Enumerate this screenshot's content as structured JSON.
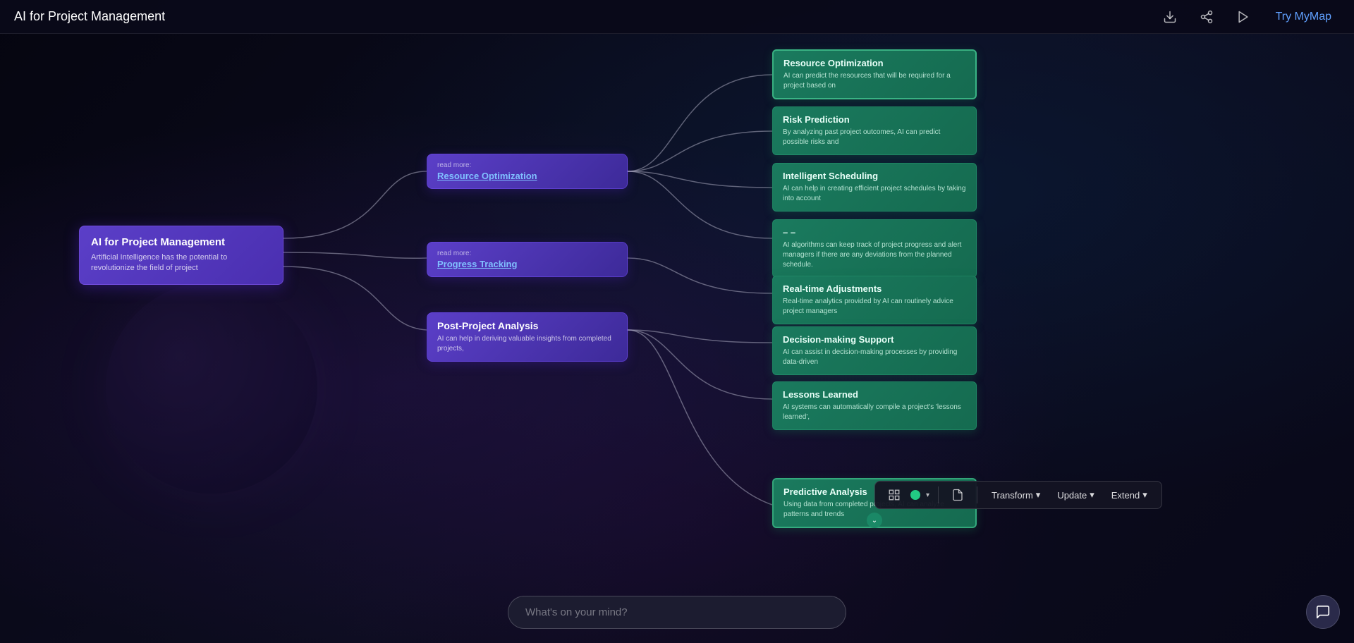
{
  "header": {
    "title": "AI for Project Management",
    "try_mymap_label": "Try MyMap"
  },
  "toolbar": {
    "transform_label": "Transform",
    "update_label": "Update",
    "extend_label": "Extend"
  },
  "chat": {
    "placeholder": "What's on your mind?"
  },
  "nodes": {
    "root": {
      "title": "AI for Project Management",
      "description": "Artificial Intelligence has the potential to revolutionize the field of project"
    },
    "branches": [
      {
        "id": "resource-opt",
        "read_more": "read more:",
        "link": "Resource Optimization"
      },
      {
        "id": "progress-tracking",
        "read_more": "read more:",
        "link": "Progress Tracking"
      },
      {
        "id": "post-project",
        "title": "Post-Project Analysis",
        "description": "AI can help in deriving valuable insights from completed projects,"
      }
    ],
    "leaves": [
      {
        "id": "resource-optimization",
        "title": "Resource Optimization",
        "description": "AI can predict the resources that will be required for a project based on",
        "active": true
      },
      {
        "id": "risk-prediction",
        "title": "Risk Prediction",
        "description": "By analyzing past project outcomes, AI can predict possible risks and",
        "active": false
      },
      {
        "id": "intelligent-scheduling",
        "title": "Intelligent Scheduling",
        "description": "AI can help in creating efficient project schedules by taking into account",
        "active": false
      },
      {
        "id": "progress-tracking-leaf",
        "title": "– –",
        "description": "AI algorithms can keep track of project progress and alert managers if there are any deviations from the planned schedule.",
        "active": false
      },
      {
        "id": "realtime-adjustments",
        "title": "Real-time Adjustments",
        "description": "Real-time analytics provided by AI can routinely advice project managers",
        "active": false
      },
      {
        "id": "decision-support",
        "title": "Decision-making Support",
        "description": "AI can assist in decision-making processes by providing data-driven",
        "active": false
      },
      {
        "id": "lessons-learned",
        "title": "Lessons Learned",
        "description": "AI systems can automatically compile a project's 'lessons learned',",
        "active": false
      },
      {
        "id": "predictive-analysis",
        "title": "Predictive Analysis",
        "description": "Using data from completed projects, AI can analyze patterns and trends",
        "active": false,
        "has_expand": true
      }
    ]
  }
}
